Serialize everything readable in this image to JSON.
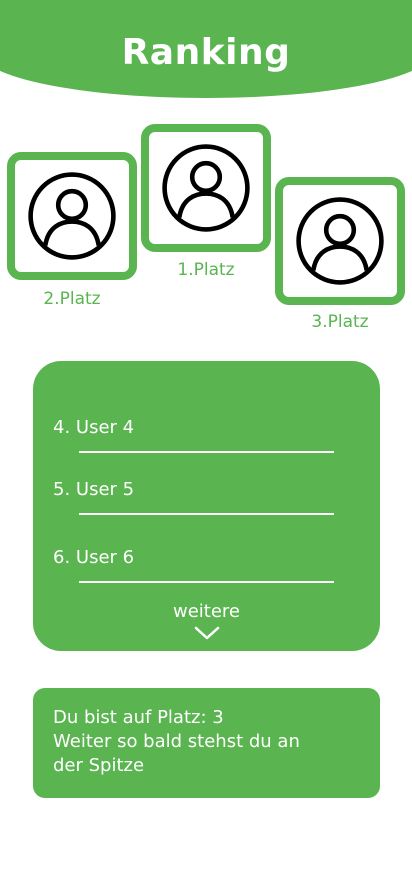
{
  "header": {
    "title": "Ranking"
  },
  "podium": {
    "first": {
      "label": "1.Platz",
      "icon": "user-avatar-icon"
    },
    "second": {
      "label": "2.Platz",
      "icon": "user-avatar-icon"
    },
    "third": {
      "label": "3.Platz",
      "icon": "user-avatar-icon"
    }
  },
  "ranking_list": {
    "items": [
      {
        "label": "4. User 4"
      },
      {
        "label": "5. User 5"
      },
      {
        "label": "6. User 6"
      }
    ],
    "more_label": "weitere",
    "more_icon": "chevron-down-icon"
  },
  "status": {
    "line1": "Du bist auf Platz: 3",
    "line2": "Weiter so bald stehst du an",
    "line3": "der Spitze"
  },
  "colors": {
    "accent": "#5ab450",
    "background": "#ffffff",
    "text_on_accent": "#ffffff"
  }
}
